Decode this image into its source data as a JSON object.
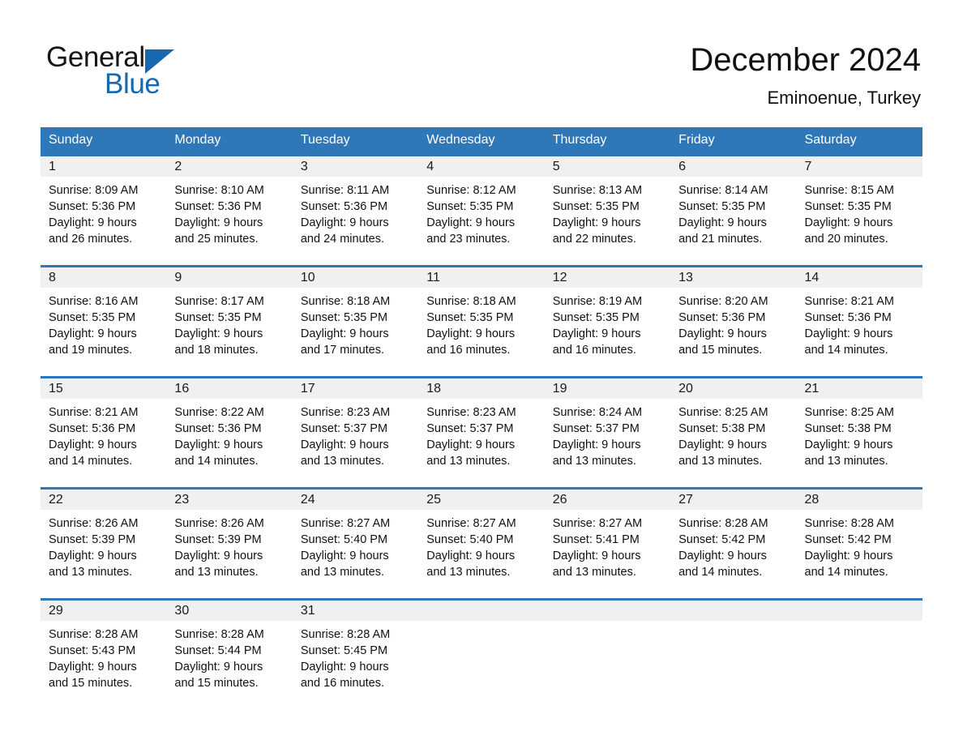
{
  "brand": {
    "word_general": "General",
    "word_blue": "Blue",
    "triangle_color": "#1668b0",
    "logo_icon": "triangle-icon"
  },
  "header": {
    "month_title": "December 2024",
    "location": "Eminoenue, Turkey",
    "accent_color": "#2e77b8",
    "band_color": "#f0f0f0"
  },
  "weekdays": [
    "Sunday",
    "Monday",
    "Tuesday",
    "Wednesday",
    "Thursday",
    "Friday",
    "Saturday"
  ],
  "weeks": [
    [
      {
        "day": "1",
        "sunrise": "Sunrise: 8:09 AM",
        "sunset": "Sunset: 5:36 PM",
        "daylight_line1": "Daylight: 9 hours",
        "daylight_line2": "and 26 minutes."
      },
      {
        "day": "2",
        "sunrise": "Sunrise: 8:10 AM",
        "sunset": "Sunset: 5:36 PM",
        "daylight_line1": "Daylight: 9 hours",
        "daylight_line2": "and 25 minutes."
      },
      {
        "day": "3",
        "sunrise": "Sunrise: 8:11 AM",
        "sunset": "Sunset: 5:36 PM",
        "daylight_line1": "Daylight: 9 hours",
        "daylight_line2": "and 24 minutes."
      },
      {
        "day": "4",
        "sunrise": "Sunrise: 8:12 AM",
        "sunset": "Sunset: 5:35 PM",
        "daylight_line1": "Daylight: 9 hours",
        "daylight_line2": "and 23 minutes."
      },
      {
        "day": "5",
        "sunrise": "Sunrise: 8:13 AM",
        "sunset": "Sunset: 5:35 PM",
        "daylight_line1": "Daylight: 9 hours",
        "daylight_line2": "and 22 minutes."
      },
      {
        "day": "6",
        "sunrise": "Sunrise: 8:14 AM",
        "sunset": "Sunset: 5:35 PM",
        "daylight_line1": "Daylight: 9 hours",
        "daylight_line2": "and 21 minutes."
      },
      {
        "day": "7",
        "sunrise": "Sunrise: 8:15 AM",
        "sunset": "Sunset: 5:35 PM",
        "daylight_line1": "Daylight: 9 hours",
        "daylight_line2": "and 20 minutes."
      }
    ],
    [
      {
        "day": "8",
        "sunrise": "Sunrise: 8:16 AM",
        "sunset": "Sunset: 5:35 PM",
        "daylight_line1": "Daylight: 9 hours",
        "daylight_line2": "and 19 minutes."
      },
      {
        "day": "9",
        "sunrise": "Sunrise: 8:17 AM",
        "sunset": "Sunset: 5:35 PM",
        "daylight_line1": "Daylight: 9 hours",
        "daylight_line2": "and 18 minutes."
      },
      {
        "day": "10",
        "sunrise": "Sunrise: 8:18 AM",
        "sunset": "Sunset: 5:35 PM",
        "daylight_line1": "Daylight: 9 hours",
        "daylight_line2": "and 17 minutes."
      },
      {
        "day": "11",
        "sunrise": "Sunrise: 8:18 AM",
        "sunset": "Sunset: 5:35 PM",
        "daylight_line1": "Daylight: 9 hours",
        "daylight_line2": "and 16 minutes."
      },
      {
        "day": "12",
        "sunrise": "Sunrise: 8:19 AM",
        "sunset": "Sunset: 5:35 PM",
        "daylight_line1": "Daylight: 9 hours",
        "daylight_line2": "and 16 minutes."
      },
      {
        "day": "13",
        "sunrise": "Sunrise: 8:20 AM",
        "sunset": "Sunset: 5:36 PM",
        "daylight_line1": "Daylight: 9 hours",
        "daylight_line2": "and 15 minutes."
      },
      {
        "day": "14",
        "sunrise": "Sunrise: 8:21 AM",
        "sunset": "Sunset: 5:36 PM",
        "daylight_line1": "Daylight: 9 hours",
        "daylight_line2": "and 14 minutes."
      }
    ],
    [
      {
        "day": "15",
        "sunrise": "Sunrise: 8:21 AM",
        "sunset": "Sunset: 5:36 PM",
        "daylight_line1": "Daylight: 9 hours",
        "daylight_line2": "and 14 minutes."
      },
      {
        "day": "16",
        "sunrise": "Sunrise: 8:22 AM",
        "sunset": "Sunset: 5:36 PM",
        "daylight_line1": "Daylight: 9 hours",
        "daylight_line2": "and 14 minutes."
      },
      {
        "day": "17",
        "sunrise": "Sunrise: 8:23 AM",
        "sunset": "Sunset: 5:37 PM",
        "daylight_line1": "Daylight: 9 hours",
        "daylight_line2": "and 13 minutes."
      },
      {
        "day": "18",
        "sunrise": "Sunrise: 8:23 AM",
        "sunset": "Sunset: 5:37 PM",
        "daylight_line1": "Daylight: 9 hours",
        "daylight_line2": "and 13 minutes."
      },
      {
        "day": "19",
        "sunrise": "Sunrise: 8:24 AM",
        "sunset": "Sunset: 5:37 PM",
        "daylight_line1": "Daylight: 9 hours",
        "daylight_line2": "and 13 minutes."
      },
      {
        "day": "20",
        "sunrise": "Sunrise: 8:25 AM",
        "sunset": "Sunset: 5:38 PM",
        "daylight_line1": "Daylight: 9 hours",
        "daylight_line2": "and 13 minutes."
      },
      {
        "day": "21",
        "sunrise": "Sunrise: 8:25 AM",
        "sunset": "Sunset: 5:38 PM",
        "daylight_line1": "Daylight: 9 hours",
        "daylight_line2": "and 13 minutes."
      }
    ],
    [
      {
        "day": "22",
        "sunrise": "Sunrise: 8:26 AM",
        "sunset": "Sunset: 5:39 PM",
        "daylight_line1": "Daylight: 9 hours",
        "daylight_line2": "and 13 minutes."
      },
      {
        "day": "23",
        "sunrise": "Sunrise: 8:26 AM",
        "sunset": "Sunset: 5:39 PM",
        "daylight_line1": "Daylight: 9 hours",
        "daylight_line2": "and 13 minutes."
      },
      {
        "day": "24",
        "sunrise": "Sunrise: 8:27 AM",
        "sunset": "Sunset: 5:40 PM",
        "daylight_line1": "Daylight: 9 hours",
        "daylight_line2": "and 13 minutes."
      },
      {
        "day": "25",
        "sunrise": "Sunrise: 8:27 AM",
        "sunset": "Sunset: 5:40 PM",
        "daylight_line1": "Daylight: 9 hours",
        "daylight_line2": "and 13 minutes."
      },
      {
        "day": "26",
        "sunrise": "Sunrise: 8:27 AM",
        "sunset": "Sunset: 5:41 PM",
        "daylight_line1": "Daylight: 9 hours",
        "daylight_line2": "and 13 minutes."
      },
      {
        "day": "27",
        "sunrise": "Sunrise: 8:28 AM",
        "sunset": "Sunset: 5:42 PM",
        "daylight_line1": "Daylight: 9 hours",
        "daylight_line2": "and 14 minutes."
      },
      {
        "day": "28",
        "sunrise": "Sunrise: 8:28 AM",
        "sunset": "Sunset: 5:42 PM",
        "daylight_line1": "Daylight: 9 hours",
        "daylight_line2": "and 14 minutes."
      }
    ],
    [
      {
        "day": "29",
        "sunrise": "Sunrise: 8:28 AM",
        "sunset": "Sunset: 5:43 PM",
        "daylight_line1": "Daylight: 9 hours",
        "daylight_line2": "and 15 minutes."
      },
      {
        "day": "30",
        "sunrise": "Sunrise: 8:28 AM",
        "sunset": "Sunset: 5:44 PM",
        "daylight_line1": "Daylight: 9 hours",
        "daylight_line2": "and 15 minutes."
      },
      {
        "day": "31",
        "sunrise": "Sunrise: 8:28 AM",
        "sunset": "Sunset: 5:45 PM",
        "daylight_line1": "Daylight: 9 hours",
        "daylight_line2": "and 16 minutes."
      },
      {
        "day": "",
        "sunrise": "",
        "sunset": "",
        "daylight_line1": "",
        "daylight_line2": ""
      },
      {
        "day": "",
        "sunrise": "",
        "sunset": "",
        "daylight_line1": "",
        "daylight_line2": ""
      },
      {
        "day": "",
        "sunrise": "",
        "sunset": "",
        "daylight_line1": "",
        "daylight_line2": ""
      },
      {
        "day": "",
        "sunrise": "",
        "sunset": "",
        "daylight_line1": "",
        "daylight_line2": ""
      }
    ]
  ]
}
